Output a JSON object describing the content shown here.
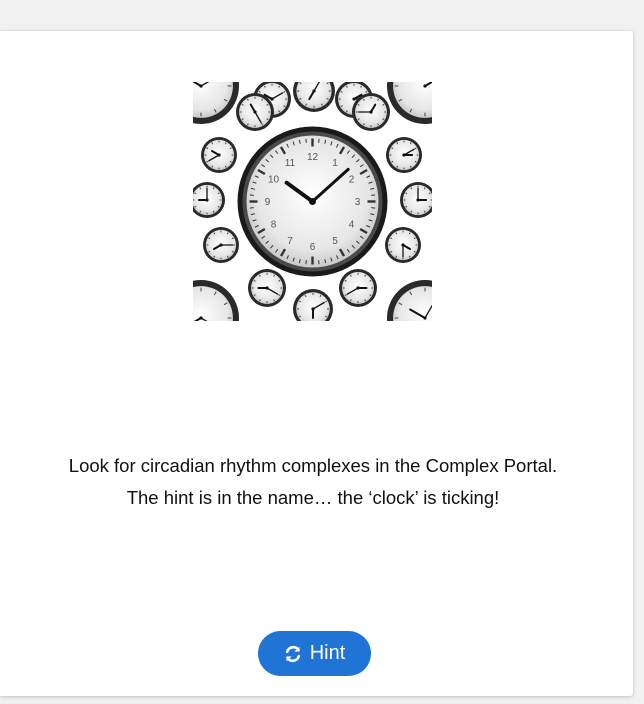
{
  "illustration": {
    "icon": "clock-collage-icon",
    "clock_numerals": [
      "12",
      "1",
      "2",
      "3",
      "4",
      "5",
      "6",
      "7",
      "8",
      "9",
      "10",
      "11"
    ]
  },
  "message": {
    "line1": "Look for circadian rhythm complexes in the Complex Portal.",
    "line2": "The hint is in the name… the ‘clock’ is ticking!"
  },
  "hint_button": {
    "label": "Hint",
    "icon": "refresh-icon",
    "color": "#1f74d6"
  }
}
